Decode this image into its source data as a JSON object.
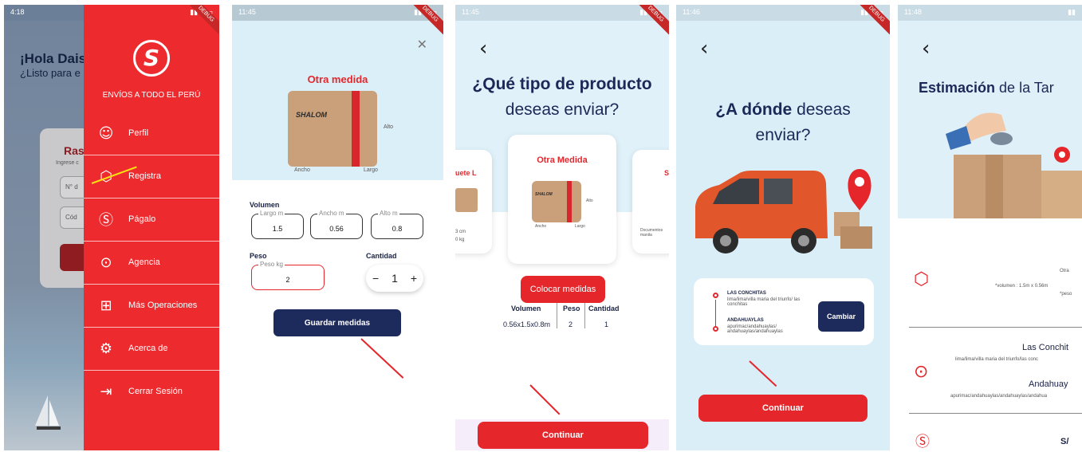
{
  "screen1": {
    "status_time": "4:18",
    "greeting": "¡Hola Dais",
    "greeting_sub": "¿Listo para e",
    "card_title": "Ras",
    "card_sub": "Ingrese c",
    "field1": "N° d",
    "field2": "Cód",
    "drawer": {
      "logo": "S",
      "debug": "DEBUG",
      "tagline": "ENVÍOS A TODO EL PERÚ",
      "items": [
        {
          "label": "Perfil",
          "icon": "person-icon"
        },
        {
          "label": "Registra",
          "icon": "package-icon"
        },
        {
          "label": "Págalo",
          "icon": "soles-icon"
        },
        {
          "label": "Agencia",
          "icon": "location-icon"
        },
        {
          "label": "Más Operaciones",
          "icon": "grid-add-icon"
        },
        {
          "label": "Acerca de",
          "icon": "gear-icon"
        },
        {
          "label": "Cerrar Sesión",
          "icon": "logout-icon"
        }
      ]
    }
  },
  "screen2": {
    "status_time": "11:45",
    "debug": "DEBUG",
    "title": "Otra medida",
    "box_brand": "SHALOM",
    "dims": {
      "alto": "Alto",
      "ancho": "Ancho",
      "largo": "Largo"
    },
    "volumen_label": "Volumen",
    "largo_ph": "Largo m",
    "largo_val": "1.5",
    "ancho_ph": "Ancho m",
    "ancho_val": "0.56",
    "alto_ph": "Alto m",
    "alto_val": "0.8",
    "peso_label": "Peso",
    "peso_ph": "Peso kg",
    "peso_val": "2",
    "cantidad_label": "Cantidad",
    "cantidad_val": "1",
    "save_btn": "Guardar medidas"
  },
  "screen3": {
    "status_time": "11:45",
    "debug": "DEBUG",
    "title_bold": "¿Qué tipo de producto",
    "title_rest": "deseas enviar?",
    "left_card_label": "uete L",
    "left_card_dims": "3 cm",
    "left_card_weight": "0 kg",
    "center_card_title": "Otra Medida",
    "center_box_brand": "SHALOM",
    "center_dims": {
      "alto": "Alto",
      "ancho": "Ancho",
      "largo": "Largo"
    },
    "right_card_label": "S",
    "right_card_text": "Documentos\nmanila",
    "measure_btn": "Colocar medidas",
    "table_headers": [
      "Volumen",
      "Peso",
      "Cantidad"
    ],
    "table_values": [
      "0.56x1.5x0.8m",
      "2",
      "1"
    ],
    "continue_btn": "Continuar"
  },
  "screen4": {
    "status_time": "11:46",
    "debug": "DEBUG",
    "title_bold": "¿A dónde",
    "title_rest": "deseas",
    "title_line2": "enviar?",
    "origin_title": "LAS CONCHITAS",
    "origin_addr": "lima/lima/villa maria del triunfo/ las conchitas",
    "dest_title": "ANDAHUAYLAS",
    "dest_addr": "apurimac/andahuaylas/ andahuaylas/andahuaylas",
    "change_btn": "Cambiar",
    "continue_btn": "Continuar"
  },
  "screen5": {
    "status_time": "11:48",
    "title_bold": "Estimación",
    "title_rest": "de la Tar",
    "otra": "Otra",
    "volumen_text": "*volumen : 1.5m x 0.56m",
    "peso_text": "*peso",
    "origin_name": "Las Conchit",
    "origin_addr": "lima/lima/villa maria del triunfo/las conc",
    "dest_name": "Andahuay",
    "dest_addr": "apurimac/andahuaylas/andahuaylas/andahua",
    "price_prefix": "S/"
  },
  "colors": {
    "brand_red": "#e5262b",
    "navy": "#1d2a5c",
    "light_blue": "#daeef8",
    "highlight_arrow": "#f7e314"
  }
}
